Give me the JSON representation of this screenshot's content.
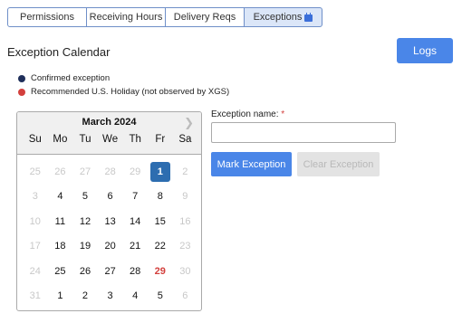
{
  "tabs": [
    {
      "label": "Permissions",
      "active": false
    },
    {
      "label": "Receiving Hours",
      "active": false
    },
    {
      "label": "Delivery Reqs",
      "active": false
    },
    {
      "label": "Exceptions",
      "active": true,
      "icon": "calendar-icon"
    }
  ],
  "page": {
    "title": "Exception Calendar",
    "logs_label": "Logs"
  },
  "legend": [
    {
      "label": "Confirmed exception",
      "color": "#1f2f5a"
    },
    {
      "label": "Recommended U.S. Holiday (not observed by XGS)",
      "color": "#d3403d"
    }
  ],
  "calendar": {
    "month_label": "March 2024",
    "next_icon": "chevron-right-icon",
    "weekdays": [
      "Su",
      "Mo",
      "Tu",
      "We",
      "Th",
      "Fr",
      "Sa"
    ],
    "weeks": [
      [
        {
          "d": "25",
          "out": true
        },
        {
          "d": "26",
          "out": true
        },
        {
          "d": "27",
          "out": true
        },
        {
          "d": "28",
          "out": true
        },
        {
          "d": "29",
          "out": true
        },
        {
          "d": "1",
          "confirmed": true
        },
        {
          "d": "2",
          "out": true
        }
      ],
      [
        {
          "d": "3",
          "out": true
        },
        {
          "d": "4"
        },
        {
          "d": "5"
        },
        {
          "d": "6"
        },
        {
          "d": "7"
        },
        {
          "d": "8"
        },
        {
          "d": "9",
          "out": true
        }
      ],
      [
        {
          "d": "10",
          "out": true
        },
        {
          "d": "11"
        },
        {
          "d": "12"
        },
        {
          "d": "13"
        },
        {
          "d": "14"
        },
        {
          "d": "15"
        },
        {
          "d": "16",
          "out": true
        }
      ],
      [
        {
          "d": "17",
          "out": true
        },
        {
          "d": "18"
        },
        {
          "d": "19"
        },
        {
          "d": "20"
        },
        {
          "d": "21"
        },
        {
          "d": "22"
        },
        {
          "d": "23",
          "out": true
        }
      ],
      [
        {
          "d": "24",
          "out": true
        },
        {
          "d": "25"
        },
        {
          "d": "26"
        },
        {
          "d": "27"
        },
        {
          "d": "28"
        },
        {
          "d": "29",
          "holiday": true
        },
        {
          "d": "30",
          "out": true
        }
      ],
      [
        {
          "d": "31",
          "out": true
        },
        {
          "d": "1"
        },
        {
          "d": "2"
        },
        {
          "d": "3"
        },
        {
          "d": "4"
        },
        {
          "d": "5"
        },
        {
          "d": "6",
          "out": true
        }
      ]
    ]
  },
  "form": {
    "label": "Exception name:",
    "required_mark": "*",
    "value": "",
    "placeholder": "",
    "mark_label": "Mark Exception",
    "clear_label": "Clear Exception"
  }
}
